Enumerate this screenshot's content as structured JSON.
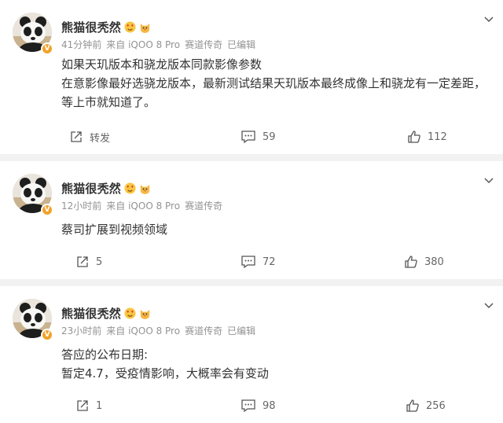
{
  "posts": [
    {
      "username": "熊猫很秃然",
      "time": "41分钟前",
      "source": "来自 iQOO 8 Pro",
      "topic": "赛道传奇",
      "edited": "已编辑",
      "lines": [
        "如果天玑版本和骁龙版本同款影像参数",
        "在意影像最好选骁龙版本，最新测试结果天玑版本最终成像上和骁龙有一定差距，等上市就知道了。"
      ],
      "repost_label": "转发",
      "comment_count": "59",
      "like_count": "112"
    },
    {
      "username": "熊猫很秃然",
      "time": "12小时前",
      "source": "来自 iQOO 8 Pro",
      "topic": "赛道传奇",
      "edited": "",
      "lines": [
        "蔡司扩展到视频领域"
      ],
      "repost_label": "5",
      "comment_count": "72",
      "like_count": "380"
    },
    {
      "username": "熊猫很秃然",
      "time": "23小时前",
      "source": "来自 iQOO 8 Pro",
      "topic": "赛道传奇",
      "edited": "已编辑",
      "lines": [
        "答应的公布日期:",
        "暂定4.7，受疫情影响，大概率会有变动"
      ],
      "repost_label": "1",
      "comment_count": "98",
      "like_count": "256"
    }
  ],
  "icons": {
    "verified_badge": "V",
    "emoji_1": "heart-eyes-emoji-icon",
    "emoji_2": "cat-emoji-icon",
    "repost": "repost-icon",
    "comment": "comment-icon",
    "like": "thumbs-up-icon",
    "more": "chevron-down-icon"
  },
  "colors": {
    "text": "#333333",
    "meta": "#939393",
    "badge": "#f1a22a",
    "background": "#f2f2f2"
  }
}
